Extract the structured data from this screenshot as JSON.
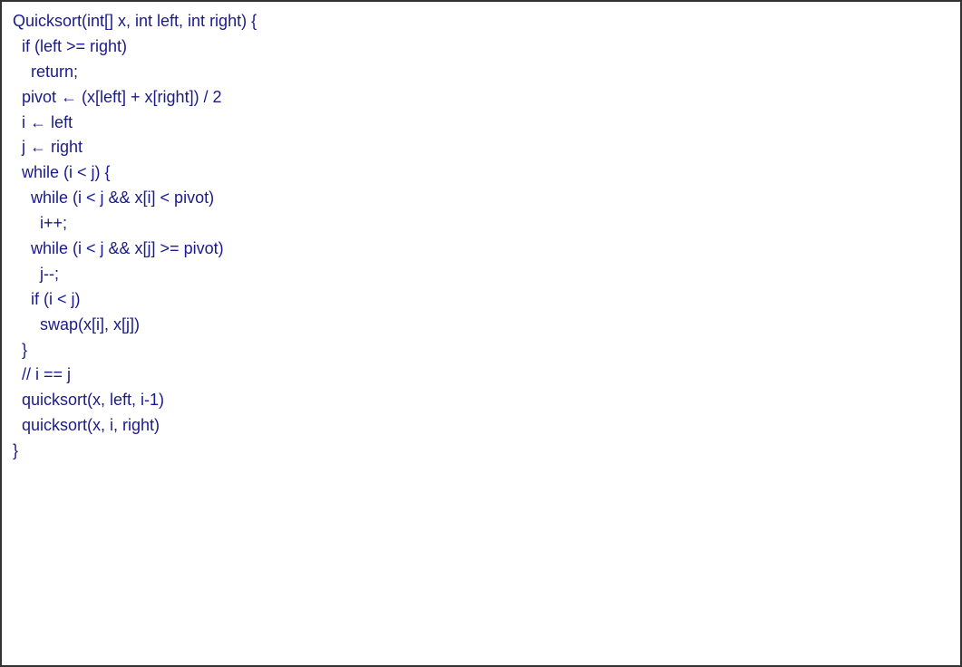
{
  "code": {
    "lines": [
      {
        "text": "Quicksort(int[] x, int left, int right) {",
        "indent": 0
      },
      {
        "text": "if (left >= right)",
        "indent": 1
      },
      {
        "text": "return;",
        "indent": 2
      },
      {
        "text": "pivot ← (x[left] + x[right]) / 2",
        "indent": 1
      },
      {
        "text": "i ← left",
        "indent": 1
      },
      {
        "text": "j ← right",
        "indent": 1
      },
      {
        "text": "while (i < j) {",
        "indent": 1
      },
      {
        "text": "while (i < j && x[i] < pivot)",
        "indent": 2
      },
      {
        "text": "i++;",
        "indent": 3
      },
      {
        "text": "while (i < j && x[j] >= pivot)",
        "indent": 2
      },
      {
        "text": "j--;",
        "indent": 3
      },
      {
        "text": "if (i < j)",
        "indent": 2
      },
      {
        "text": "swap(x[i], x[j])",
        "indent": 3
      },
      {
        "text": "}",
        "indent": 1
      },
      {
        "text": "// i == j",
        "indent": 1
      },
      {
        "text": "quicksort(x, left, i-1)",
        "indent": 1
      },
      {
        "text": "quicksort(x, i, right)",
        "indent": 1
      },
      {
        "text": "}",
        "indent": 0
      }
    ]
  }
}
